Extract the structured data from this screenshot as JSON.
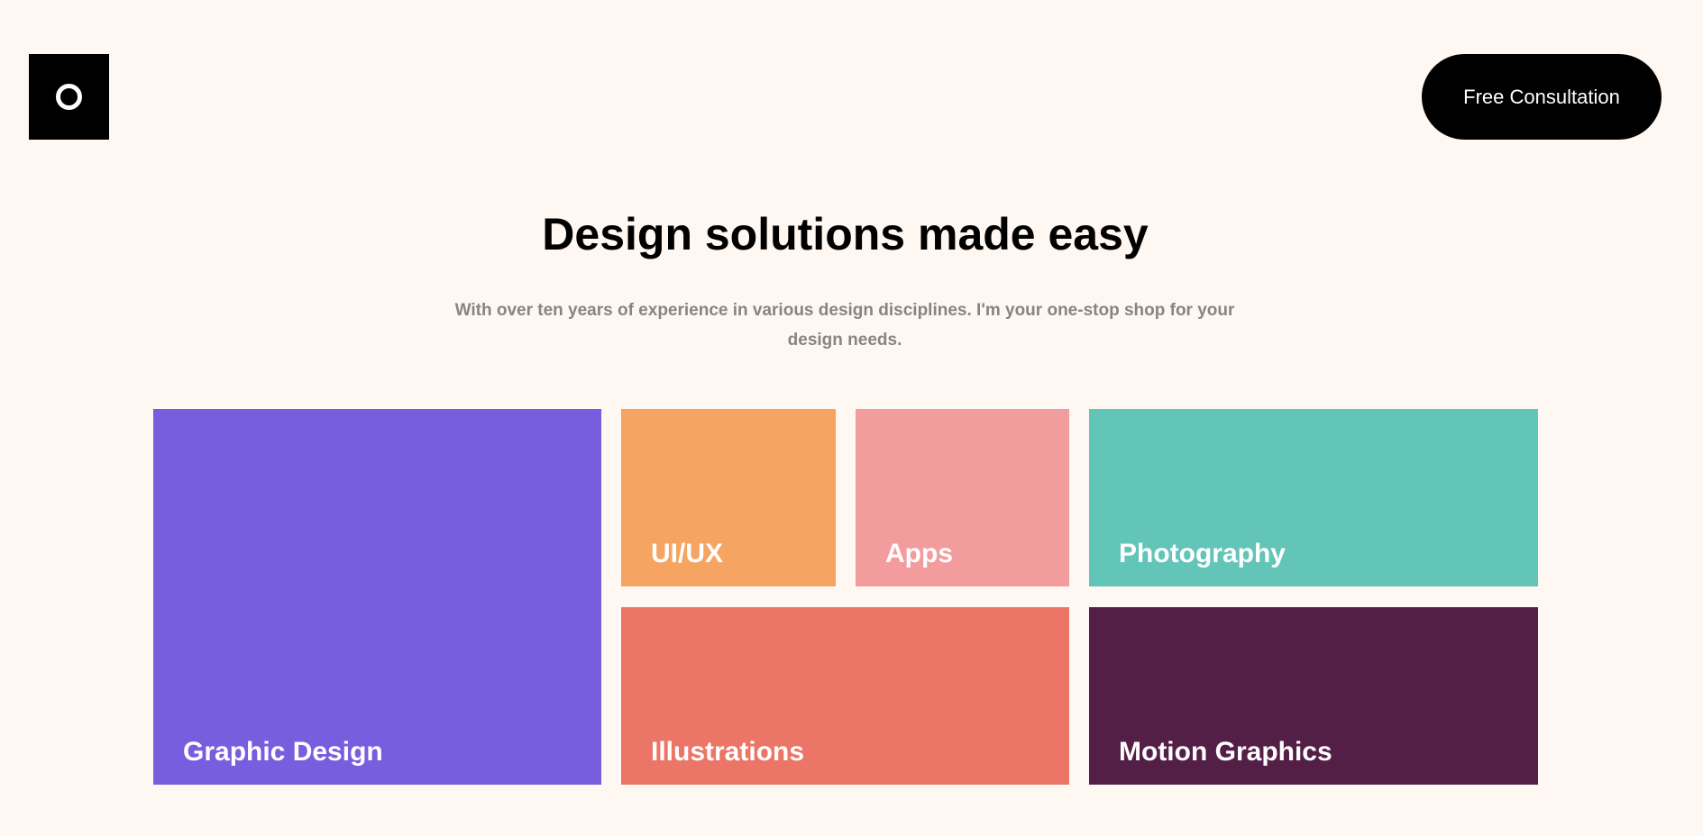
{
  "header": {
    "logo_icon": "circle-ring-icon",
    "cta_label": "Free Consultation"
  },
  "hero": {
    "title": "Design solutions made easy",
    "subtitle": "With over ten years of experience in various design disciplines. I'm your one-stop shop for your design needs."
  },
  "services": [
    {
      "label": "Graphic Design",
      "color": "#775ede"
    },
    {
      "label": "UI/UX",
      "color": "#f5a462"
    },
    {
      "label": "Apps",
      "color": "#f39c9e"
    },
    {
      "label": "Photography",
      "color": "#63c4b8"
    },
    {
      "label": "Illustrations",
      "color": "#eb7566"
    },
    {
      "label": "Motion Graphics",
      "color": "#541f47"
    }
  ],
  "colors": {
    "background": "#fff7f1",
    "text": "#000000",
    "subtitle": "#8a8480"
  }
}
